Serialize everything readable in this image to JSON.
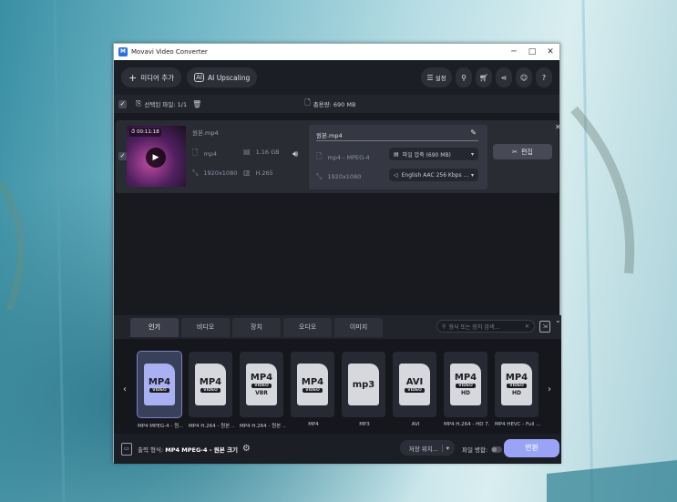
{
  "window": {
    "title": "Movavi Video Converter",
    "app_icon": "movavi-logo-icon"
  },
  "toolbar": {
    "add_media": "미디어 추가",
    "ai_upscaling": "AI Upscaling",
    "settings": "설정"
  },
  "selection": {
    "selected_label": "선택된 파일: 1/1",
    "total_size": "총용량: 690 MB"
  },
  "file": {
    "duration": "00:11:18",
    "source_name": "원본.mp4",
    "source_format": "mp4",
    "source_size": "1.16 GB",
    "source_resolution": "1920x1080",
    "source_codec": "H.265",
    "output_name": "원본.mp4",
    "output_format": "mp4 - MPEG-4",
    "compression": "파일 압축 (690 MB)",
    "output_resolution": "1920x1080",
    "audio": "English AAC 256 Kbps ...",
    "edit": "편집"
  },
  "tabs": [
    "인기",
    "비디오",
    "장치",
    "오디오",
    "이미지"
  ],
  "search": {
    "placeholder": "형식 또는 장치 검색..."
  },
  "formats": [
    {
      "icon": "MP4",
      "tag": "VIDEO",
      "sub": "",
      "label": "MP4 MPEG-4 - 원..."
    },
    {
      "icon": "MP4",
      "tag": "VIDEO",
      "sub": "",
      "label": "MP4 H.264 - 원본 ..."
    },
    {
      "icon": "MP4",
      "tag": "VIDEO",
      "sub": "VBR",
      "label": "MP4 H.264 - 원본 ..."
    },
    {
      "icon": "MP4",
      "tag": "VIDEO",
      "sub": "",
      "label": "MP4"
    },
    {
      "icon": "mp3",
      "tag": "",
      "sub": "",
      "label": "MP3"
    },
    {
      "icon": "AVI",
      "tag": "VIDEO",
      "sub": "",
      "label": "AVI"
    },
    {
      "icon": "MP4",
      "tag": "VIDEO",
      "sub": "HD",
      "label": "MP4 H.264 - HD 7..."
    },
    {
      "icon": "MP4",
      "tag": "VIDEO",
      "sub": "HD",
      "label": "MP4 HEVC - Full ..."
    }
  ],
  "bottom": {
    "output_label": "출력 형식:",
    "output_value": "MP4 MPEG-4 - 원본 크기",
    "save_to": "저장 위치...",
    "merge": "파일 병합:",
    "convert": "변환"
  }
}
